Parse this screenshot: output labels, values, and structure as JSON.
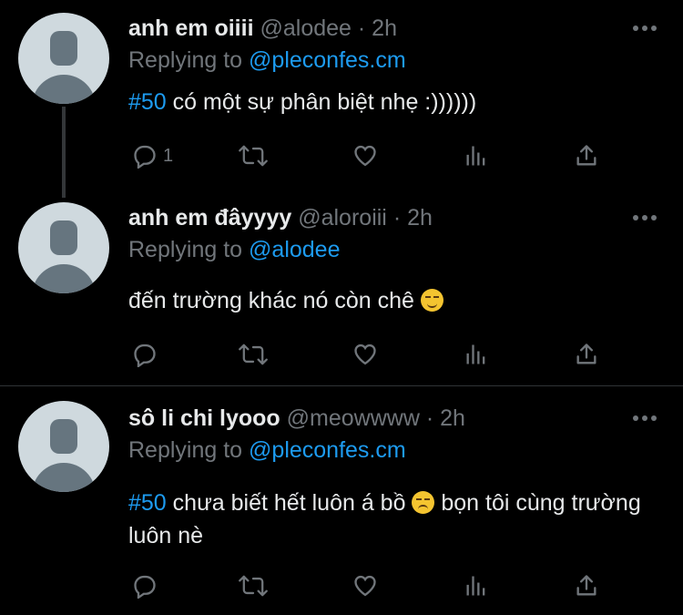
{
  "colors": {
    "background": "#000000",
    "text": "#e7e9ea",
    "muted": "#71767b",
    "accent": "#1d9bf0"
  },
  "tweets": [
    {
      "name": "anh em oiiii",
      "handle": "@alodee",
      "dot": "·",
      "time": "2h",
      "replying_prefix": "Replying to",
      "replying_to": "@pleconfes.cm",
      "hashtag": "#50",
      "text": " có một sự phân biệt nhẹ :))))))",
      "reply_count": "1"
    },
    {
      "name": "anh em đâyyyy",
      "handle": "@aloroiii",
      "dot": "·",
      "time": "2h",
      "replying_prefix": "Replying to",
      "replying_to": "@alodee",
      "text": "đến trường khác nó còn chê ",
      "emoji": "smirking-face-emoji"
    },
    {
      "name": "sô li chi lyooo",
      "handle": "@meowwww",
      "dot": "·",
      "time": "2h",
      "replying_prefix": "Replying to",
      "replying_to": "@pleconfes.cm",
      "hashtag": "#50",
      "text_before": " chưa biết hết luôn á bồ ",
      "emoji": "disappointed-face-emoji",
      "text_after": "  bọn tôi cùng trường luôn nè"
    }
  ],
  "icons": [
    "reply-icon",
    "retweet-icon",
    "like-icon",
    "analytics-icon",
    "share-icon",
    "more-icon"
  ]
}
